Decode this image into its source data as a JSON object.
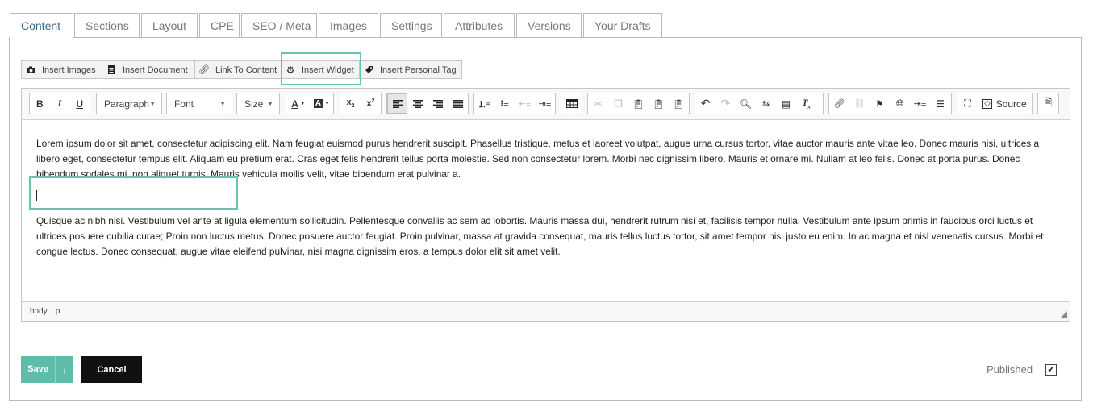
{
  "tabs": [
    {
      "label": "Content"
    },
    {
      "label": "Sections"
    },
    {
      "label": "Layout"
    },
    {
      "label": "CPE"
    },
    {
      "label": "SEO / Meta"
    },
    {
      "label": "Images"
    },
    {
      "label": "Settings"
    },
    {
      "label": "Attributes"
    },
    {
      "label": "Versions"
    },
    {
      "label": "Your Drafts"
    }
  ],
  "insert_bar": {
    "insert_images": "Insert Images",
    "insert_document": "Insert Document",
    "link_to_content": "Link To Content",
    "insert_widget": "Insert Widget",
    "insert_personal_tag": "Insert Personal Tag"
  },
  "toolbar": {
    "bold": "B",
    "italic": "I",
    "underline": "U",
    "format_combo": "Paragraph",
    "font_combo": "Font",
    "size_combo": "Size",
    "source_label": "Source"
  },
  "editor": {
    "paragraph1": "Lorem ipsum dolor sit amet, consectetur adipiscing elit. Nam feugiat euismod purus hendrerit suscipit. Phasellus tristique, metus et laoreet volutpat, augue urna cursus tortor, vitae auctor mauris ante vitae leo. Donec mauris nisi, ultrices a libero eget, consectetur tempus elit. Aliquam eu pretium erat. Cras eget felis hendrerit tellus porta molestie. Sed non consectetur lorem. Morbi nec dignissim libero. Mauris et ornare mi. Nullam at leo felis. Donec at porta purus. Donec bibendum sodales mi, non aliquet turpis. Mauris vehicula mollis velit, vitae bibendum erat pulvinar a.",
    "paragraph2": "Quisque ac nibh nisi. Vestibulum vel ante at ligula elementum sollicitudin. Pellentesque convallis ac sem ac lobortis. Mauris massa dui, hendrerit rutrum nisi et, facilisis tempor nulla. Vestibulum ante ipsum primis in faucibus orci luctus et ultrices posuere cubilia curae; Proin non luctus metus. Donec posuere auctor feugiat. Proin pulvinar, massa at gravida consequat, mauris tellus luctus tortor, sit amet tempor nisi justo eu enim. In ac magna et nisl venenatis cursus. Morbi et congue lectus. Donec consequat, augue vitae eleifend pulvinar, nisi magna dignissim eros, a tempus dolor elit sit amet velit.",
    "path": [
      "body",
      "p"
    ]
  },
  "footer": {
    "save_label": "Save",
    "save_dropdown": "↓",
    "cancel_label": "Cancel",
    "published_label": "Published",
    "published_checked": true
  },
  "colors": {
    "accent": "#5dbdaa",
    "highlight": "#64c4b1",
    "cancel": "#111111"
  }
}
